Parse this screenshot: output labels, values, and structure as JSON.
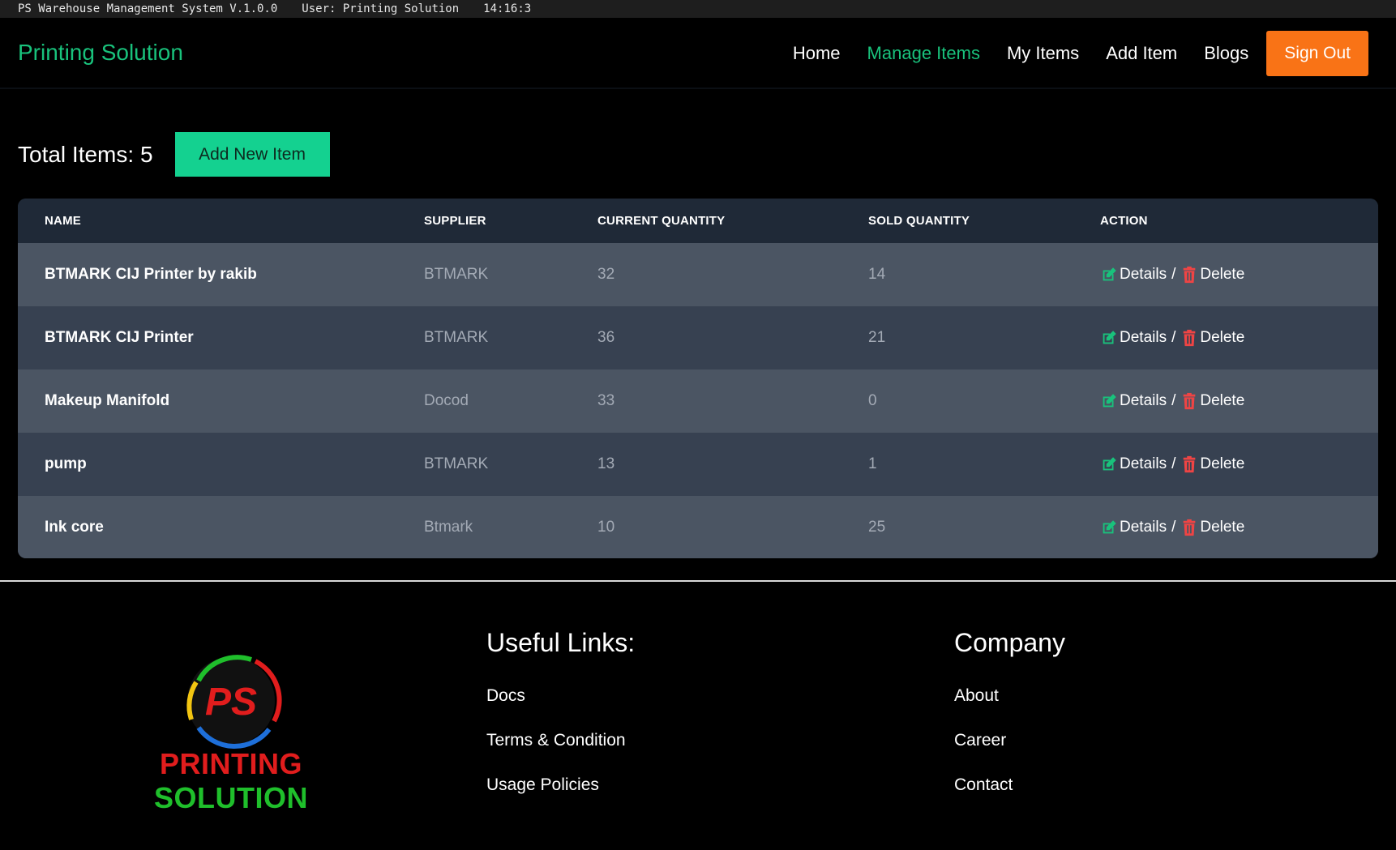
{
  "status_bar": {
    "app": "PS Warehouse Management System V.1.0.0",
    "user": "User: Printing Solution",
    "time": "14:16:3"
  },
  "nav": {
    "brand": "Printing Solution",
    "links": [
      "Home",
      "Manage Items",
      "My Items",
      "Add Item",
      "Blogs"
    ],
    "active": "Manage Items",
    "sign_out": "Sign Out"
  },
  "summary": {
    "total_label": "Total Items: 5",
    "add_button": "Add New Item"
  },
  "table": {
    "headers": [
      "NAME",
      "SUPPLIER",
      "CURRENT QUANTITY",
      "SOLD QUANTITY",
      "ACTION"
    ],
    "rows": [
      {
        "name": "BTMARK CIJ Printer by rakib",
        "supplier": "BTMARK",
        "current": "32",
        "sold": "14"
      },
      {
        "name": "BTMARK CIJ Printer",
        "supplier": "BTMARK",
        "current": "36",
        "sold": "21"
      },
      {
        "name": "Makeup Manifold",
        "supplier": "Docod",
        "current": "33",
        "sold": "0"
      },
      {
        "name": "pump",
        "supplier": "BTMARK",
        "current": "13",
        "sold": "1"
      },
      {
        "name": "Ink core",
        "supplier": "Btmark",
        "current": "10",
        "sold": "25"
      }
    ],
    "action_details": "Details",
    "action_sep": "/",
    "action_delete": "Delete"
  },
  "footer": {
    "logo_text_red": "PRINTING",
    "logo_text_green": "SOLUTION",
    "logo_mark": "PS",
    "useful_links_title": "Useful Links:",
    "useful_links": [
      "Docs",
      "Terms & Condition",
      "Usage Policies"
    ],
    "company_title": "Company",
    "company_links": [
      "About",
      "Career",
      "Contact"
    ]
  },
  "colors": {
    "accent_green": "#19c27c",
    "button_green": "#14d190",
    "sign_out_orange": "#f97316",
    "delete_red": "#ef4444"
  }
}
